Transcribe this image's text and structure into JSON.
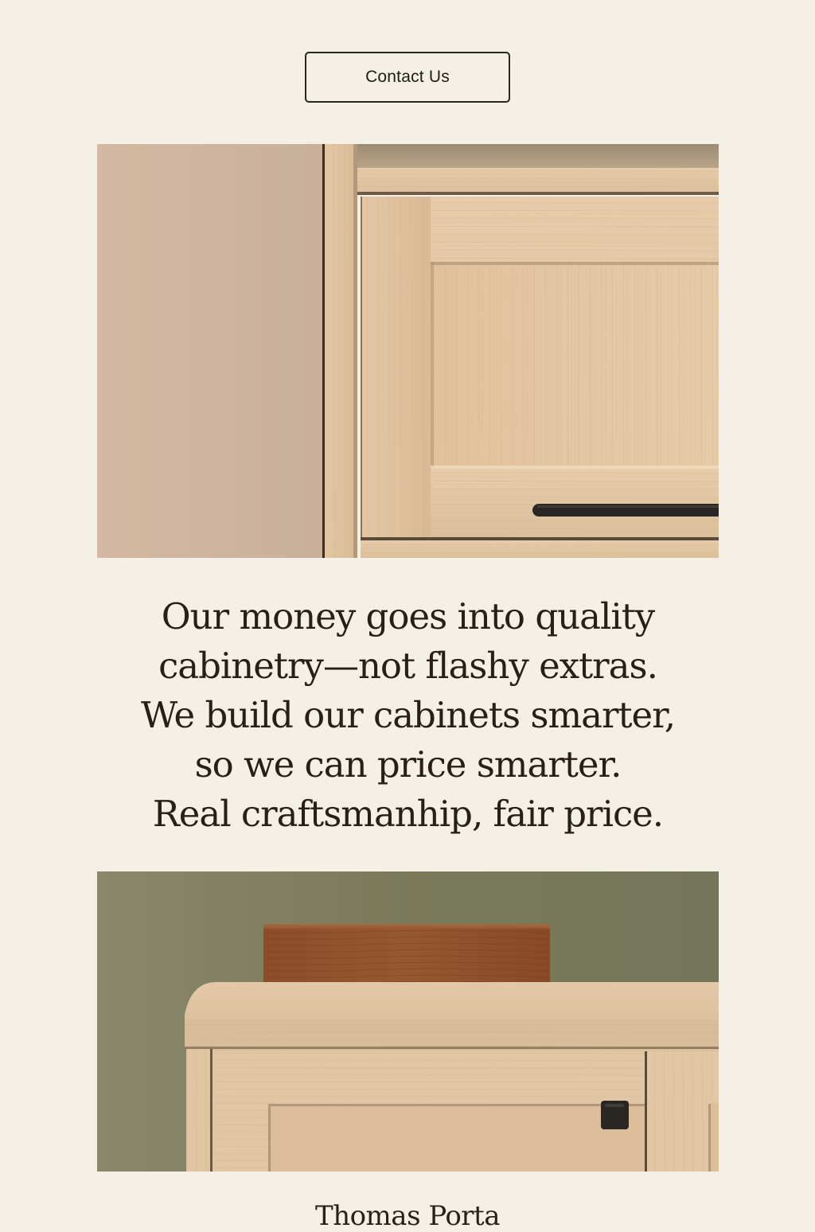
{
  "header": {
    "contact_label": "Contact Us"
  },
  "images": {
    "top": {
      "icon": "cabinet-drawer-closeup-image"
    },
    "bottom": {
      "icon": "cabinet-with-wooden-box-image"
    }
  },
  "quote": {
    "lines": [
      "Our money goes into quality",
      "cabinetry—not flashy extras.",
      "We build our cabinets smarter,",
      "so we can price smarter.",
      "Real craftsmanhip, fair price."
    ]
  },
  "signature": {
    "name": "Thomas Porta"
  },
  "colors": {
    "background": "#f4f0e5",
    "text": "#2a1f17",
    "oak": "#d9bf9d",
    "sage_wall": "#7d7c5c",
    "walnut": "#8c4e2a"
  }
}
